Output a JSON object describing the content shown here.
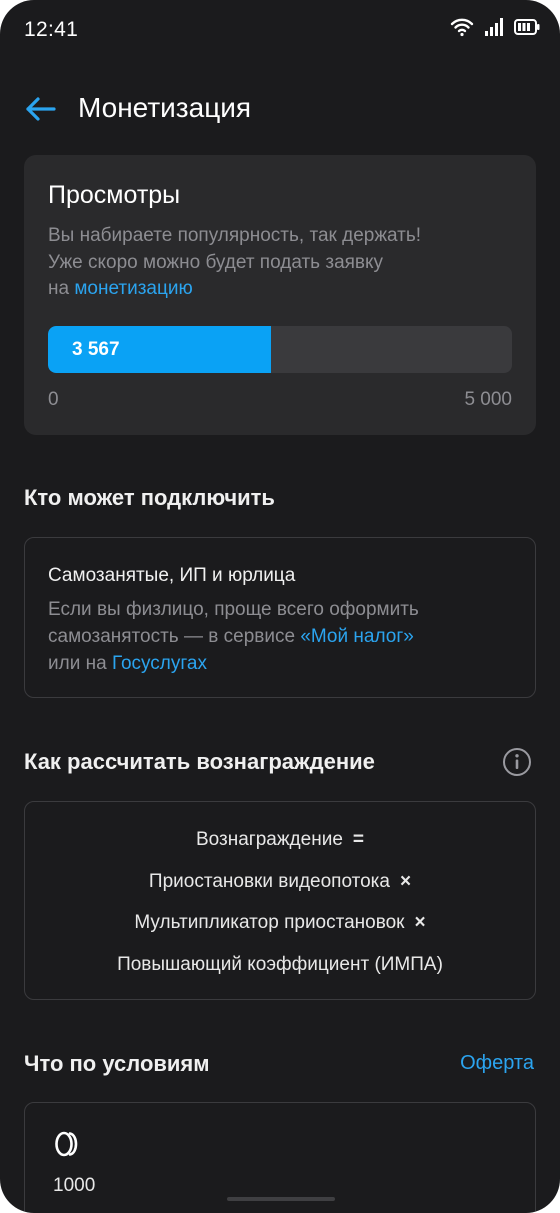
{
  "status_bar": {
    "time": "12:41"
  },
  "header": {
    "title": "Монетизация"
  },
  "views": {
    "title": "Просмотры",
    "desc_line1": "Вы набираете популярность, так держать!",
    "desc_line2": "Уже скоро можно будет подать заявку",
    "desc_prefix": "на ",
    "desc_link": "монетизацию",
    "current_label": "3 567",
    "progress_fraction": 0.4807,
    "scale_min": "0",
    "scale_max": "5 000"
  },
  "who": {
    "section_title": "Кто может подключить",
    "card_title": "Самозанятые, ИП и юрлица",
    "desc_line1": "Если вы физлицо, проще всего оформить",
    "desc_line2_prefix": "самозанятость — в сервисе ",
    "desc_link1": "«Мой налог»",
    "desc_line3_prefix": "или на ",
    "desc_link2": "Госуслугах"
  },
  "reward": {
    "section_title": "Как рассчитать вознаграждение",
    "lines": [
      {
        "text": "Вознаграждение",
        "op": "="
      },
      {
        "text": "Приостановки видеопотока",
        "op": "×"
      },
      {
        "text": "Мультипликатор приостановок",
        "op": "×"
      },
      {
        "text": "Повышающий коэффициент (ИМПА)",
        "op": ""
      }
    ]
  },
  "conditions": {
    "section_title": "Что по условиям",
    "offer_link": "Оферта",
    "partial_text": "1000"
  },
  "colors": {
    "background": "#1b1b1d",
    "card": "#2a2a2c",
    "accent": "#0aa2f5",
    "link": "#2ba4ef",
    "muted_text": "#8d8d92"
  },
  "icons": [
    "wifi-icon",
    "signal-icon",
    "battery-icon",
    "back-arrow-icon",
    "info-icon",
    "coins-icon"
  ]
}
